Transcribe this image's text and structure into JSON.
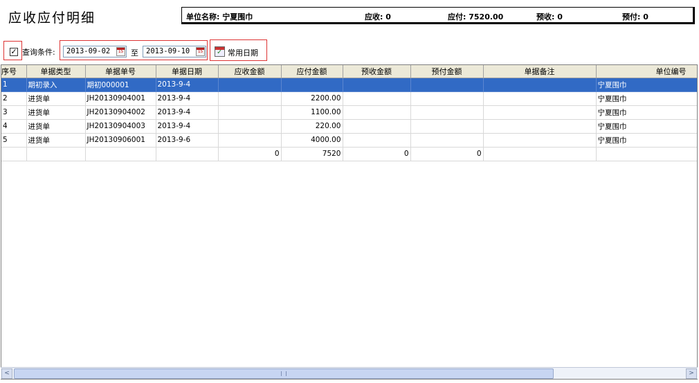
{
  "page": {
    "title": "应收应付明细"
  },
  "info": {
    "unit_name": "单位名称: 宁夏围巾",
    "receivable": "应收: 0",
    "payable": "应付: 7520.00",
    "prepaid_received": "预收: 0",
    "prepaid_paid": "预付: 0"
  },
  "query": {
    "checked": "✓",
    "label": "查询条件:",
    "date_from": "2013-09-02",
    "separator": "至",
    "date_to": "2013-09-10",
    "calendar_icon_text": "15",
    "common_dates_label": "常用日期"
  },
  "table": {
    "columns": [
      "序号",
      "单据类型",
      "单据单号",
      "单据日期",
      "应收金额",
      "应付金额",
      "预收金额",
      "预付金额",
      "单据备注",
      "单位编号"
    ],
    "rows": [
      [
        "1",
        "期初录入",
        "期初000001",
        "2013-9-4",
        "",
        "",
        "",
        "",
        "",
        "宁夏围巾"
      ],
      [
        "2",
        "进货单",
        "JH20130904001",
        "2013-9-4",
        "",
        "2200.00",
        "",
        "",
        "",
        "宁夏围巾"
      ],
      [
        "3",
        "进货单",
        "JH20130904002",
        "2013-9-4",
        "",
        "1100.00",
        "",
        "",
        "",
        "宁夏围巾"
      ],
      [
        "4",
        "进货单",
        "JH20130904003",
        "2013-9-4",
        "",
        "220.00",
        "",
        "",
        "",
        "宁夏围巾"
      ],
      [
        "5",
        "进货单",
        "JH20130906001",
        "2013-9-6",
        "",
        "4000.00",
        "",
        "",
        "",
        "宁夏围巾"
      ]
    ],
    "totals": [
      "",
      "",
      "",
      "",
      "0",
      "7520",
      "0",
      "0",
      "",
      ""
    ],
    "selected_row": 0
  },
  "scrollbar": {
    "left_arrow": "<",
    "right_arrow": ">"
  },
  "colors": {
    "selection": "#316ac5",
    "highlight_border": "#dd3333",
    "header_bg": "#ece9d8"
  }
}
